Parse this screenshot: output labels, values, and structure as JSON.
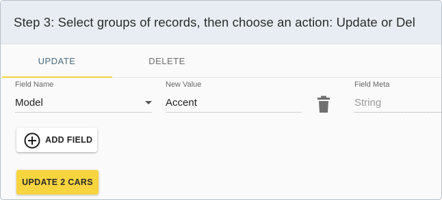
{
  "header": {
    "title": "Step 3: Select groups of records, then choose an action: Update or Del"
  },
  "tabs": [
    {
      "label": "UPDATE",
      "active": true
    },
    {
      "label": "DELETE",
      "active": false
    }
  ],
  "fields": {
    "field_name": {
      "label": "Field Name",
      "value": "Model"
    },
    "new_value": {
      "label": "New Value",
      "value": "Accent"
    },
    "field_meta": {
      "label": "Field Meta",
      "value": "String"
    }
  },
  "buttons": {
    "add_field": "ADD FIELD",
    "update": "UPDATE 2 CARS"
  },
  "colors": {
    "accent_yellow": "#f8d43e",
    "header_bg": "#e8edf3",
    "active_tab_text": "#4d6a80"
  },
  "icons": {
    "dropdown": "chevron-down-icon",
    "delete": "trash-icon",
    "add": "plus-circle-icon"
  }
}
